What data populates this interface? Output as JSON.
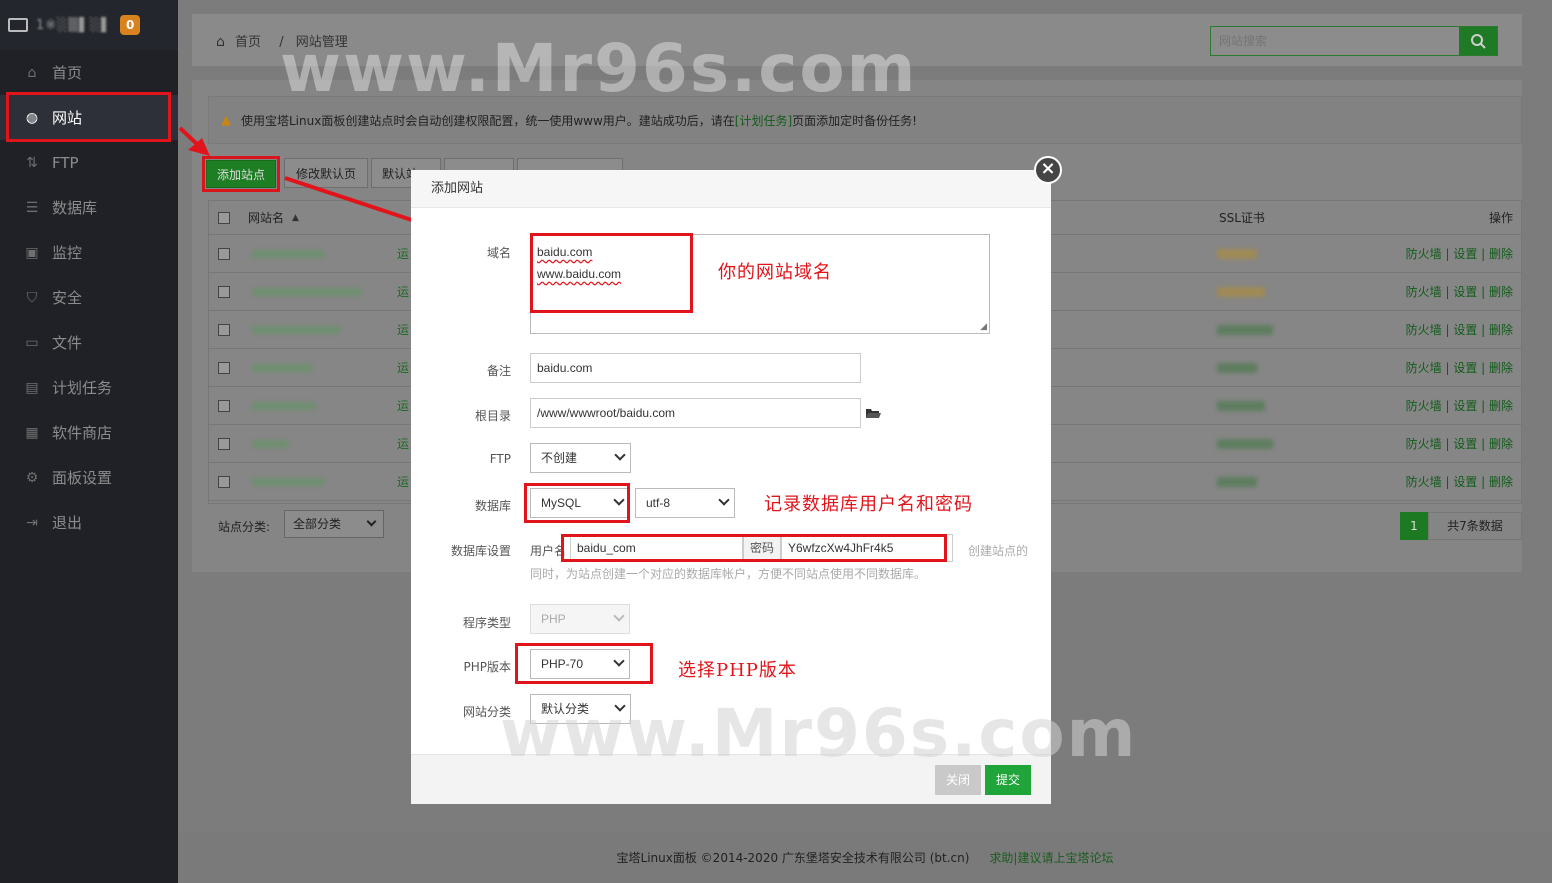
{
  "sidebar": {
    "host": "1※░▒▌░▌",
    "badge": "0",
    "items": [
      {
        "label": "首页",
        "icon": "home-icon"
      },
      {
        "label": "网站",
        "icon": "globe-icon"
      },
      {
        "label": "FTP",
        "icon": "ftp-icon"
      },
      {
        "label": "数据库",
        "icon": "database-icon"
      },
      {
        "label": "监控",
        "icon": "monitor-icon"
      },
      {
        "label": "安全",
        "icon": "shield-icon"
      },
      {
        "label": "文件",
        "icon": "folder-icon"
      },
      {
        "label": "计划任务",
        "icon": "calendar-icon"
      },
      {
        "label": "软件商店",
        "icon": "grid-icon"
      },
      {
        "label": "面板设置",
        "icon": "gear-icon"
      },
      {
        "label": "退出",
        "icon": "logout-icon"
      }
    ]
  },
  "breadcrumb": {
    "home": "首页",
    "sep": "/",
    "current": "网站管理"
  },
  "search": {
    "placeholder": "网站搜索"
  },
  "notice": {
    "text": "使用宝塔Linux面板创建站点时会自动创建权限配置，统一使用www用户。建站成功后，请在",
    "link": "[计划任务]",
    "after": "页面添加定时备份任务!"
  },
  "toolbar": {
    "add": "添加站点",
    "edit_default": "修改默认页",
    "default_site": "默认站"
  },
  "table": {
    "headers": {
      "name": "网站名",
      "ssl": "SSL证书",
      "ops": "操作"
    },
    "status": "运",
    "ops": "防火墙 | 设置 | 删除",
    "row_count": 7
  },
  "pager": {
    "category_label": "站点分类:",
    "category_value": "全部分类",
    "page": "1",
    "total": "共7条数据"
  },
  "footer": {
    "copyright": "宝塔Linux面板 ©2014-2020 广东堡塔安全技术有限公司 (bt.cn)",
    "link": "求助|建议请上宝塔论坛"
  },
  "watermark": "www.Mr96s.com",
  "modal": {
    "title": "添加网站",
    "close": "×",
    "domain_label": "域名",
    "domain_lines": [
      "baidu.com",
      "www.baidu.com"
    ],
    "domain_anno": "你的网站域名",
    "remark_label": "备注",
    "remark_value": "baidu.com",
    "root_label": "根目录",
    "root_value": "/www/wwwroot/baidu.com",
    "ftp_label": "FTP",
    "ftp_value": "不创建",
    "db_label": "数据库",
    "db_value": "MySQL",
    "db_charset": "utf-8",
    "db_anno": "记录数据库用户名和密码",
    "dbset_label": "数据库设置",
    "db_user_label": "用户名",
    "db_user_value": "baidu_com",
    "db_pass_label": "密码",
    "db_pass_value": "Y6wfzcXw4JhFr4k5",
    "db_hint1": "创建站点的",
    "db_hint2": "同时，为站点创建一个对应的数据库帐户，方便不同站点使用不同数据库。",
    "prog_label": "程序类型",
    "prog_value": "PHP",
    "php_label": "PHP版本",
    "php_value": "PHP-70",
    "php_anno": "选择PHP版本",
    "cat_label": "网站分类",
    "cat_value": "默认分类",
    "btn_close": "关闭",
    "btn_submit": "提交"
  }
}
